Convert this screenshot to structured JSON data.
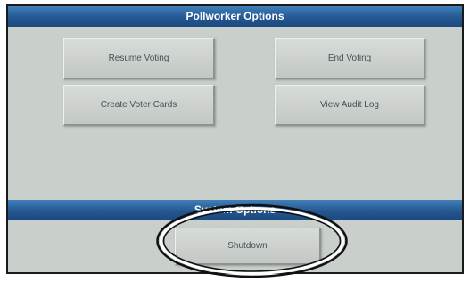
{
  "header": {
    "title": "Pollworker Options"
  },
  "buttons": {
    "resume_voting": "Resume Voting",
    "end_voting": "End Voting",
    "create_voter_cards": "Create Voter Cards",
    "view_audit_log": "View Audit Log",
    "shutdown": "Shutdown"
  },
  "system_section": {
    "title": "System Options"
  },
  "colors": {
    "header_blue": "#24558f",
    "panel_bg": "#c9cfcb",
    "button_face": "#cfd4d0"
  }
}
